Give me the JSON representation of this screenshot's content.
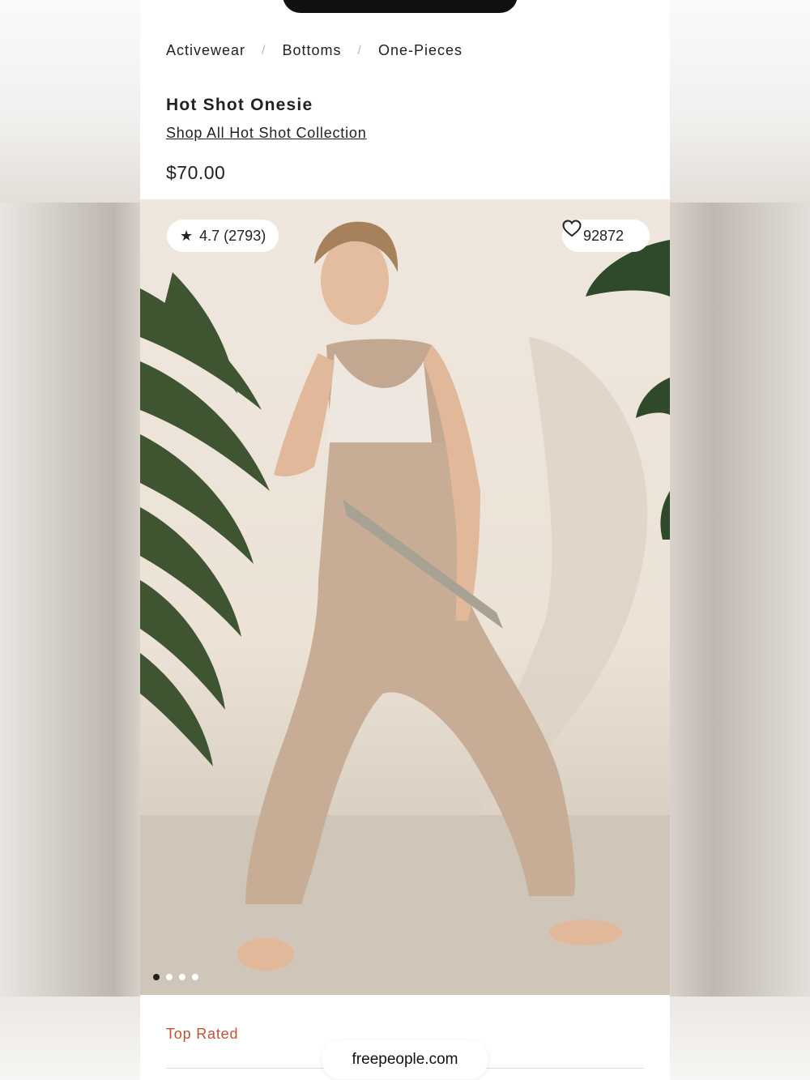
{
  "breadcrumb": {
    "items": [
      "Activewear",
      "Bottoms",
      "One-Pieces"
    ],
    "separator": "/"
  },
  "product": {
    "title": "Hot Shot Onesie",
    "collection_link": "Shop All Hot Shot Collection",
    "price": "$70.00"
  },
  "gallery": {
    "rating": "4.7 (2793)",
    "rating_icon": "star-icon",
    "favorites_count": "92872",
    "favorites_icon": "heart-icon",
    "image_count": 4,
    "active_index": 0
  },
  "badges": {
    "top_rated": "Top Rated",
    "top_rated_color": "#c4512f"
  },
  "browser": {
    "url": "freepeople.com"
  }
}
